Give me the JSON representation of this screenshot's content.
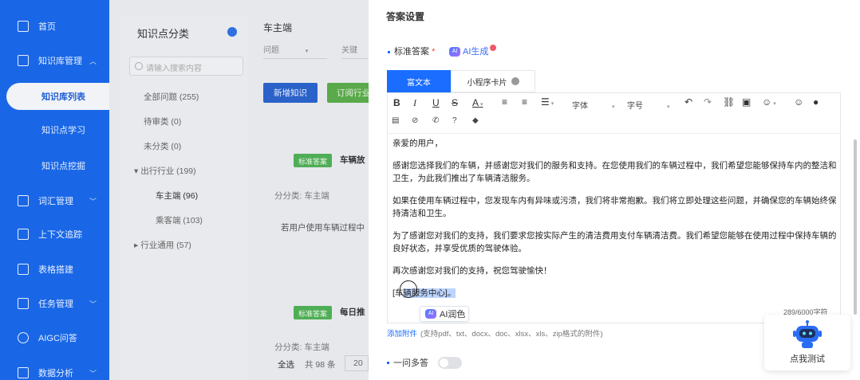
{
  "sidebar": {
    "items": [
      {
        "label": "首页",
        "icon": "home-icon"
      },
      {
        "label": "知识库管理",
        "icon": "book-icon",
        "expanded": true
      },
      {
        "label": "词汇管理",
        "icon": "vocab-icon"
      },
      {
        "label": "上下文追踪",
        "icon": "context-icon"
      },
      {
        "label": "表格搭建",
        "icon": "table-icon"
      },
      {
        "label": "任务管理",
        "icon": "task-icon"
      },
      {
        "label": "AIGC问答",
        "icon": "aigc-icon"
      },
      {
        "label": "数据分析",
        "icon": "chart-icon"
      }
    ],
    "sub_items": [
      "知识库列表",
      "知识点学习",
      "知识点挖掘"
    ],
    "active": "知识库列表"
  },
  "category": {
    "title": "知识点分类",
    "search_placeholder": "请输入搜索内容",
    "items": [
      {
        "label": "全部问题 (255)",
        "level": 0
      },
      {
        "label": "待审类 (0)",
        "level": 0
      },
      {
        "label": "未分类 (0)",
        "level": 0
      },
      {
        "label": "出行行业 (199)",
        "level": 0,
        "arrow": "▾"
      },
      {
        "label": "车主端 (96)",
        "level": 1,
        "selected": true
      },
      {
        "label": "乘客端 (103)",
        "level": 1
      },
      {
        "label": "行业通用 (57)",
        "level": 0,
        "arrow": "▸"
      }
    ]
  },
  "list": {
    "title": "车主端",
    "filter_type": "问题",
    "filter_placeholder": "关键",
    "add_button": "新增知识",
    "order_button": "订阅行业",
    "card1_tag": "标准答案",
    "card1_title": "车辆放",
    "card1_meta": "分分类: 车主端",
    "card1_text": "若用户使用车辆过程中",
    "card2_tag": "标准答案",
    "card2_title": "每日推",
    "card2_meta": "分分类: 车主端",
    "select_all": "全选",
    "total": "共 98 条",
    "page_size": "20"
  },
  "drawer": {
    "title": "答案设置",
    "std_answer_label": "标准答案",
    "required_mark": "*",
    "ai_generate": "AI生成",
    "ai_badge": "AI",
    "tabs": [
      {
        "label": "富文本",
        "active": true
      },
      {
        "label": "小程序卡片",
        "active": false
      }
    ],
    "toolbar": {
      "font": "字体",
      "size": "字号"
    },
    "content": [
      "亲爱的用户，",
      "感谢您选择我们的车辆，并感谢您对我们的服务和支持。在您使用我们的车辆过程中，我们希望您能够保持车内的整洁和卫生，为此我们推出了车辆清洁服务。",
      "如果在使用车辆过程中，您发现车内有异味或污渍，我们将非常抱歉。我们将立即处理这些问题，并确保您的车辆始终保持清洁和卫生。",
      "为了感谢您对我们的支持，我们要求您按实际产生的清洁费用支付车辆清洁费。我们希望您能够在使用过程中保持车辆的良好状态，并享受优质的驾驶体验。",
      "再次感谢您对我们的支持，祝您驾驶愉快！"
    ],
    "signature_pre": "[车",
    "signature_hl": "辆服务中心]。",
    "ai_polish": "AI润色",
    "char_count": "289/6000字符",
    "attach_link": "添加附件",
    "attach_hint": "(支持pdf、txt、docx、doc、xlsx、xls、zip格式的附件)",
    "multi_answer": "一问多答",
    "multi_answer_on": false,
    "robot_label": "点我测试"
  },
  "colors": {
    "sidebar": "#1967e6",
    "primary": "#1a6dff",
    "green": "#4fae55"
  }
}
